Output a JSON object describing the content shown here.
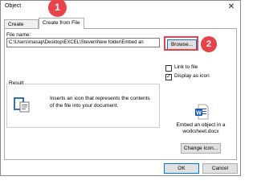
{
  "dialog": {
    "title": "Object",
    "close_glyph": "✕"
  },
  "tabs": [
    {
      "label": "Create New",
      "active": false
    },
    {
      "label": "Create from File",
      "active": true
    }
  ],
  "form": {
    "file_name_label": "File name:",
    "file_name_value": "C:\\Users\\masap\\Desktop\\EXCEL\\Steven\\New folder\\Embed an",
    "browse_label": "Browse..."
  },
  "options": {
    "link_to_file": {
      "label": "Link to file",
      "checked": false
    },
    "display_as_icon": {
      "label": "Display as icon",
      "checked": true
    }
  },
  "result": {
    "title": "Result",
    "text": "Inserts an icon that represents the contents of the file into your document."
  },
  "icon_preview": {
    "icon": "word-document-icon",
    "caption": "Embed an object in a worksheet.docx",
    "change_icon_label": "Change Icon..."
  },
  "footer": {
    "ok_label": "OK",
    "cancel_label": "Cancel"
  },
  "annotations": {
    "marker_1": "1",
    "marker_2": "2",
    "color": "#e8424b"
  },
  "colors": {
    "focus_border": "#0078d7",
    "word_blue": "#185abd"
  }
}
